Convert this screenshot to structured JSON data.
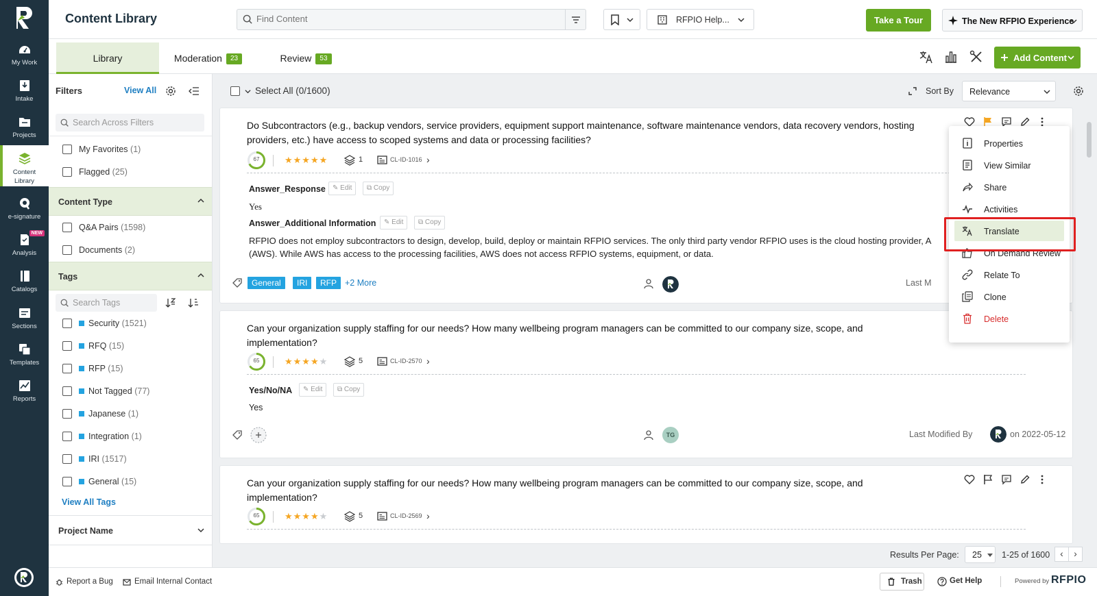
{
  "app": {
    "title": "Content Library"
  },
  "leftnav": {
    "items": [
      {
        "label": "My Work"
      },
      {
        "label": "Intake"
      },
      {
        "label": "Projects"
      },
      {
        "label": "Content Library"
      },
      {
        "label": "e-signature"
      },
      {
        "label": "Analysis",
        "badge": "NEW"
      },
      {
        "label": "Catalogs"
      },
      {
        "label": "Sections"
      },
      {
        "label": "Templates"
      },
      {
        "label": "Reports"
      }
    ]
  },
  "header": {
    "search_placeholder": "Find Content",
    "workspace": "RFPIO Help...",
    "tour": "Take a Tour",
    "experience": "The New RFPIO Experience"
  },
  "tabs": [
    {
      "label": "Library",
      "count": ""
    },
    {
      "label": "Moderation",
      "count": "23"
    },
    {
      "label": "Review",
      "count": "53"
    }
  ],
  "add_content": "Add Content",
  "filters": {
    "title": "Filters",
    "view_all": "View All",
    "search_placeholder": "Search Across Filters",
    "quick": [
      {
        "label": "My Favorites",
        "count": "(1)"
      },
      {
        "label": "Flagged",
        "count": "(25)"
      }
    ],
    "content_type": {
      "title": "Content Type",
      "items": [
        {
          "label": "Q&A Pairs",
          "count": "(1598)"
        },
        {
          "label": "Documents",
          "count": "(2)"
        }
      ]
    },
    "tags": {
      "title": "Tags",
      "search_placeholder": "Search Tags",
      "items": [
        {
          "label": "Security",
          "count": "(1521)"
        },
        {
          "label": "RFQ",
          "count": "(15)"
        },
        {
          "label": "RFP",
          "count": "(15)"
        },
        {
          "label": "Not Tagged",
          "count": "(77)"
        },
        {
          "label": "Japanese",
          "count": "(1)"
        },
        {
          "label": "Integration",
          "count": "(1)"
        },
        {
          "label": "IRI",
          "count": "(1517)"
        },
        {
          "label": "General",
          "count": "(15)"
        }
      ],
      "view_all": "View All Tags"
    },
    "project_name": "Project Name"
  },
  "listbar": {
    "select_all": "Select All (0/1600)",
    "sort_by": "Sort By",
    "sort_value": "Relevance"
  },
  "cards": [
    {
      "question": "Do Subcontractors (e.g., backup vendors, service providers, equipment support maintenance, software maintenance vendors, data recovery vendors, hosting providers, etc.) have access to scoped systems and data or processing facilities?",
      "score": "67",
      "stars": 5,
      "versions": "1",
      "id": "CL-ID-1016",
      "fields": [
        {
          "label": "Answer_Response",
          "value": "Yes"
        },
        {
          "label": "Answer_Additional Information",
          "value": "RFPIO does not employ subcontractors to design, develop, build, deploy or maintain RFPIO services. The only third party vendor RFPIO uses is the cloud hosting provider, A (AWS). While AWS has access to the processing facilities, AWS does not access RFPIO systems, equipment, or data."
        }
      ],
      "tags": [
        "General",
        "IRI",
        "RFP"
      ],
      "more_tags": "+2 More",
      "last_modified": "Last M"
    },
    {
      "question": "Can your organization supply staffing for our needs? How many wellbeing program managers can be committed to our company size, scope, and implementation?",
      "score": "65",
      "stars": 4,
      "versions": "5",
      "id": "CL-ID-2570",
      "fields": [
        {
          "label": "Yes/No/NA",
          "value": "Yes"
        }
      ],
      "owner_initials": "TG",
      "last_modified_by": "Last Modified By",
      "modified_on": "on 2022-05-12"
    },
    {
      "question": "Can your organization supply staffing for our needs? How many wellbeing program managers can be committed to our company size, scope, and implementation?",
      "score": "65",
      "stars": 4,
      "versions": "5",
      "id": "CL-ID-2569"
    }
  ],
  "buttons": {
    "edit": "Edit",
    "copy": "Copy"
  },
  "context_menu": [
    {
      "label": "Properties"
    },
    {
      "label": "View Similar"
    },
    {
      "label": "Share"
    },
    {
      "label": "Activities"
    },
    {
      "label": "Translate"
    },
    {
      "label": "On Demand Review"
    },
    {
      "label": "Relate To"
    },
    {
      "label": "Clone"
    },
    {
      "label": "Delete"
    }
  ],
  "pagination": {
    "results_per_page": "Results Per Page:",
    "per_page": "25",
    "range": "1-25 of 1600"
  },
  "footer": {
    "report_bug": "Report a Bug",
    "email": "Email Internal Contact",
    "trash": "Trash",
    "help": "Get Help",
    "powered_by": "Powered by",
    "brand": "RFPIO"
  },
  "colors": {
    "nav": "#1f3340",
    "accent": "#67a923",
    "tag": "#24a3e0",
    "highlight": "#e02020"
  }
}
